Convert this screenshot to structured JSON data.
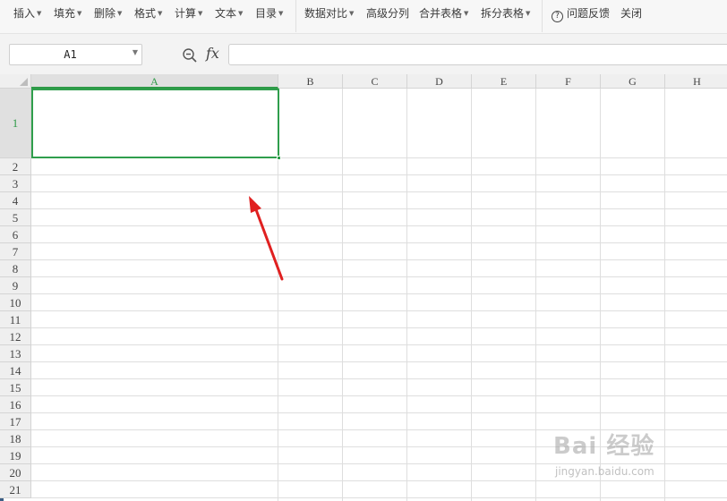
{
  "toolbar": {
    "items": [
      {
        "label": "插入",
        "dropdown": true
      },
      {
        "label": "填充",
        "dropdown": true
      },
      {
        "label": "删除",
        "dropdown": true
      },
      {
        "label": "格式",
        "dropdown": true
      },
      {
        "label": "计算",
        "dropdown": true
      },
      {
        "label": "文本",
        "dropdown": true
      },
      {
        "label": "目录",
        "dropdown": true
      },
      {
        "label": "数据对比",
        "dropdown": true
      },
      {
        "label": "高级分列",
        "dropdown": false
      },
      {
        "label": "合并表格",
        "dropdown": true
      },
      {
        "label": "拆分表格",
        "dropdown": true
      },
      {
        "label": "问题反馈",
        "dropdown": false,
        "icon": "help-circle-icon"
      },
      {
        "label": "关闭",
        "dropdown": false
      }
    ],
    "help_glyph": "?"
  },
  "formula_bar": {
    "name_box": "A1",
    "fx_label": "fx",
    "formula_value": ""
  },
  "sheet": {
    "columns": [
      "A",
      "B",
      "C",
      "D",
      "E",
      "F",
      "G",
      "H"
    ],
    "rows": [
      "1",
      "2",
      "3",
      "4",
      "5",
      "6",
      "7",
      "8",
      "9",
      "10",
      "11",
      "12",
      "13",
      "14",
      "15",
      "16",
      "17",
      "18",
      "19",
      "20",
      "21"
    ],
    "active_cell": "A1",
    "selection_color": "#2f9e4c",
    "annotation": "red-arrow-pointing-to-A1"
  },
  "watermark": {
    "logo": "Bai 经验",
    "url": "jingyan.baidu.com"
  }
}
